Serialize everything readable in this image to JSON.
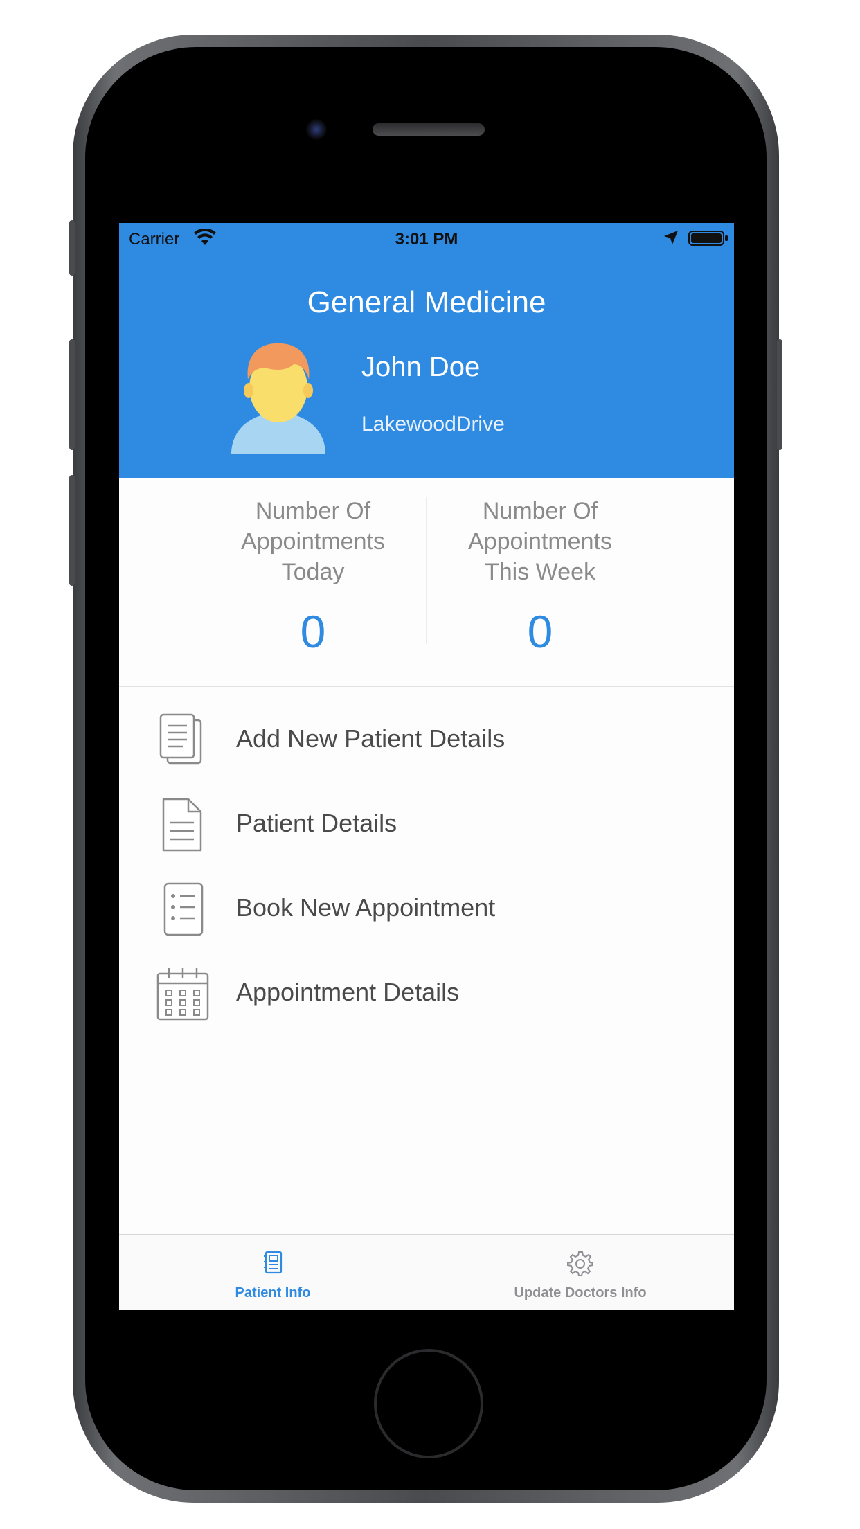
{
  "status_bar": {
    "carrier": "Carrier",
    "time": "3:01 PM",
    "icons": [
      "wifi-icon",
      "location-arrow-icon",
      "battery-icon"
    ]
  },
  "header": {
    "title": "General Medicine",
    "doctor_name": "John Doe",
    "doctor_address": "LakewoodDrive",
    "avatar_icon": "doctor-avatar-icon",
    "background_color": "#2f8ae2"
  },
  "stats": [
    {
      "label": "Number Of\nAppointments\nToday",
      "value": "0"
    },
    {
      "label": "Number Of\nAppointments\nThis Week",
      "value": "0"
    }
  ],
  "menu": {
    "items": [
      {
        "label": "Add New Patient Details",
        "icon": "documents-icon"
      },
      {
        "label": "Patient Details",
        "icon": "document-icon"
      },
      {
        "label": "Book New Appointment",
        "icon": "checklist-icon"
      },
      {
        "label": "Appointment Details",
        "icon": "calendar-icon"
      }
    ]
  },
  "tabbar": {
    "tabs": [
      {
        "label": "Patient Info",
        "icon": "notebook-icon",
        "active": true
      },
      {
        "label": "Update Doctors Info",
        "icon": "gear-icon",
        "active": false
      }
    ],
    "active_color": "#2f8ae2",
    "inactive_color": "#8e8e93"
  }
}
